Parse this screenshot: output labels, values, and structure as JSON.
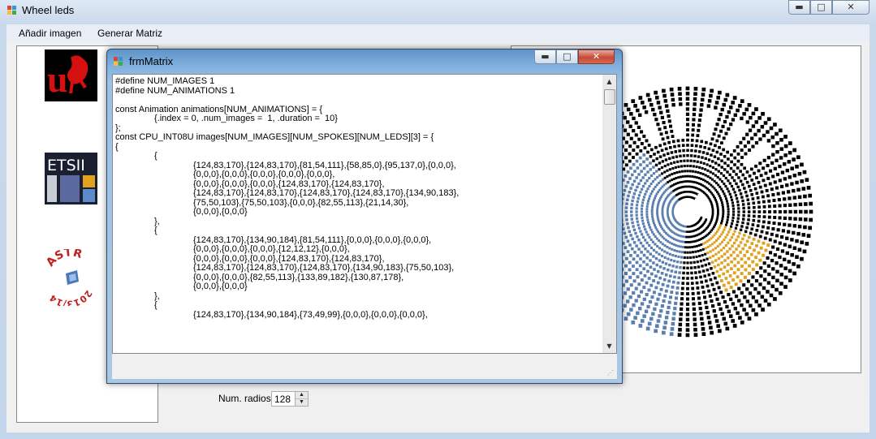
{
  "main_window": {
    "title": "Wheel leds",
    "minimize": "▬",
    "maximize": "□",
    "close": "✕"
  },
  "menu": {
    "items": [
      "Añadir imagen",
      "Generar Matriz"
    ]
  },
  "left_panel": {
    "logos": [
      {
        "name": "universidad-logo",
        "letter": "u"
      },
      {
        "name": "etsii-logo",
        "text": "ETSII"
      },
      {
        "name": "astr-logo",
        "text": "ASTR",
        "year": "2013/14"
      }
    ]
  },
  "controls": {
    "num_radios_label": "Num. radios",
    "num_radios_value": "128"
  },
  "dialog": {
    "title": "frmMatrix",
    "minimize": "▬",
    "maximize": "□",
    "close": "✕",
    "code_lines": [
      "#define NUM_IMAGES 1",
      "#define NUM_ANIMATIONS 1",
      "",
      "const Animation animations[NUM_ANIMATIONS] = {",
      "\t{.index = 0, .num_images =  1, .duration =  10}",
      "};",
      "const CPU_INT08U images[NUM_IMAGES][NUM_SPOKES][NUM_LEDS][3] = {",
      "{",
      "\t{",
      "\t\t{124,83,170},{124,83,170},{81,54,111},{58,85,0},{95,137,0},{0,0,0},",
      "\t\t{0,0,0},{0,0,0},{0,0,0},{0,0,0},{0,0,0},",
      "\t\t{0,0,0},{0,0,0},{0,0,0},{124,83,170},{124,83,170},",
      "\t\t{124,83,170},{124,83,170},{124,83,170},{124,83,170},{134,90,183},",
      "\t\t{75,50,103},{75,50,103},{0,0,0},{82,55,113},{21,14,30},",
      "\t\t{0,0,0},{0,0,0}",
      "\t},",
      "\t{",
      "\t\t{124,83,170},{134,90,184},{81,54,111},{0,0,0},{0,0,0},{0,0,0},",
      "\t\t{0,0,0},{0,0,0},{0,0,0},{12,12,12},{0,0,0},",
      "\t\t{0,0,0},{0,0,0},{0,0,0},{124,83,170},{124,83,170},",
      "\t\t{124,83,170},{124,83,170},{124,83,170},{134,90,183},{75,50,103},",
      "\t\t{0,0,0},{0,0,0},{82,55,113},{133,89,182},{130,87,178},",
      "\t\t{0,0,0},{0,0,0}",
      "\t},",
      "\t{",
      "\t\t{124,83,170},{134,90,184},{73,49,99},{0,0,0},{0,0,0},{0,0,0},"
    ]
  },
  "colors": {
    "accent_blue": "#5a7fb0",
    "accent_orange": "#e0a020",
    "logo_red": "#c00000"
  }
}
